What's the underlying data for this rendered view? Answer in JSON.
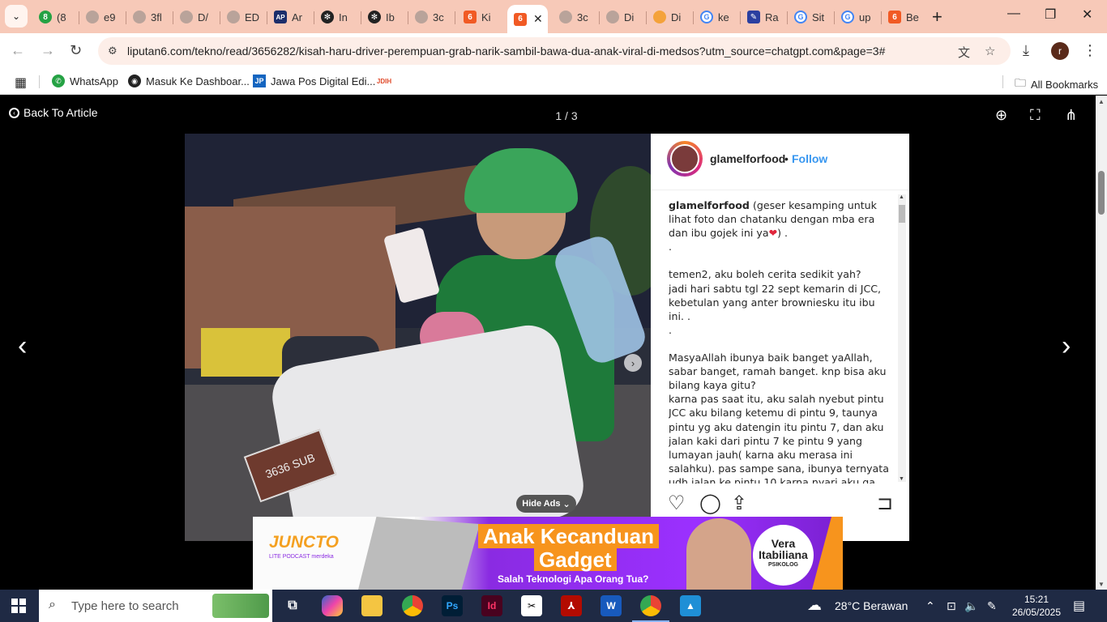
{
  "browser": {
    "tabs": [
      {
        "label": "(8",
        "icon": "whatsapp-icon"
      },
      {
        "label": "e9",
        "icon": "globe-icon"
      },
      {
        "label": "3fl",
        "icon": "globe-icon"
      },
      {
        "label": "D/",
        "icon": "globe-icon"
      },
      {
        "label": "ED",
        "icon": "globe-icon"
      },
      {
        "label": "Ar",
        "icon": "ap-icon"
      },
      {
        "label": "In",
        "icon": "openai-icon"
      },
      {
        "label": "Ib",
        "icon": "openai-icon"
      },
      {
        "label": "3c",
        "icon": "globe-icon"
      },
      {
        "label": "Ki",
        "icon": "liputan6-icon"
      },
      {
        "label": "",
        "icon": "liputan6-icon",
        "active": true
      },
      {
        "label": "3c",
        "icon": "globe-icon"
      },
      {
        "label": "Di",
        "icon": "globe-icon"
      },
      {
        "label": "Di",
        "icon": "juara-icon"
      },
      {
        "label": "ke",
        "icon": "google-icon"
      },
      {
        "label": "Ra",
        "icon": "ra-icon"
      },
      {
        "label": "Sit",
        "icon": "google-icon"
      },
      {
        "label": "up",
        "icon": "google-icon"
      },
      {
        "label": "Be",
        "icon": "liputan6-icon"
      }
    ],
    "url": "liputan6.com/tekno/read/3656282/kisah-haru-driver-perempuan-grab-narik-sambil-bawa-dua-anak-viral-di-medsos?utm_source=chatgpt.com&page=3#",
    "profile_initial": "r",
    "bookmarks": [
      {
        "label": "WhatsApp",
        "icon": "whatsapp-icon"
      },
      {
        "label": "Masuk Ke Dashboar...",
        "icon": "dashboard-icon"
      },
      {
        "label": "Jawa Pos Digital Edi...",
        "icon": "jawapos-icon"
      },
      {
        "label": "",
        "icon": "jdih-icon"
      }
    ],
    "all_bookmarks": "All Bookmarks"
  },
  "viewer": {
    "back_label": "Back To Article",
    "counter": "1 / 3",
    "plate_text": "3636 SUB",
    "hide_ads": "Hide Ads"
  },
  "instagram": {
    "username": "glamelforfood",
    "separator": "•",
    "follow": "Follow",
    "caption_intro": "(geser kesamping untuk lihat foto dan chatanku dengan mba era dan ibu gojek ini ya",
    "caption_intro_end": ") .",
    "caption_body": ".\n\ntemen2, aku boleh cerita sedikit yah?\njadi hari sabtu tgl 22 sept kemarin di JCC, kebetulan yang anter browniesku itu ibu ini. .\n.\n\nMasyaAllah ibunya baik banget yaAllah, sabar banget, ramah banget. knp bisa aku bilang kaya gitu?\nkarna pas saat itu, aku salah nyebut pintu JCC aku bilang ketemu di pintu 9, taunya pintu yg aku datengin itu pintu 7, dan aku jalan kaki dari pintu 7 ke pintu 9 yang lumayan jauh( karna aku merasa ini salahku). pas sampe sana, ibunya ternyata udh jalan ke pintu 10 karna nyari aku ga"
  },
  "ad": {
    "brand": "JUNCTO",
    "brand_sub": "LITE PODCAST merdeka",
    "title_line1": "Anak Kecanduan",
    "title_line2": "Gadget",
    "tagline": "Salah Teknologi Apa Orang Tua?",
    "speaker_name": "Vera Itabiliana",
    "speaker_role": "PSIKOLOG"
  },
  "taskbar": {
    "search_placeholder": "Type here to search",
    "apps": [
      "task-view",
      "copilot",
      "file-explorer",
      "chrome",
      "photoshop",
      "indesign",
      "capcut",
      "acrobat",
      "word",
      "chrome-active",
      "photos"
    ],
    "weather": "28°C  Berawan",
    "time": "15:21",
    "date": "26/05/2025"
  },
  "colors": {
    "tab_strip": "#f7c9b8",
    "omnibox": "#fdeee8",
    "follow": "#3897f0",
    "ad_purple": "#9b30ff",
    "ad_orange": "#f7941d",
    "taskbar": "#1f2a44"
  }
}
